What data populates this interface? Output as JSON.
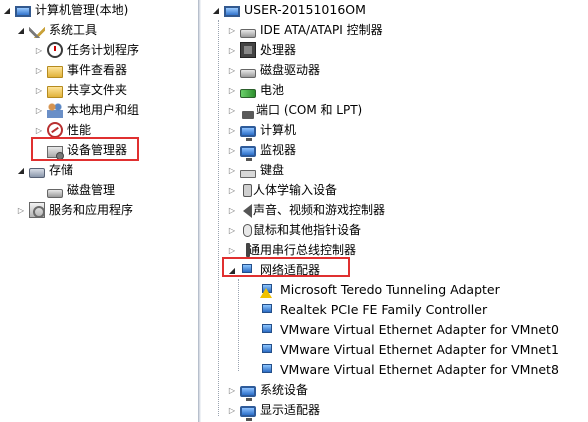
{
  "left_tree": {
    "root": "计算机管理(本地)",
    "system_tools": "系统工具",
    "task_scheduler": "任务计划程序",
    "event_viewer": "事件查看器",
    "shared_folders": "共享文件夹",
    "local_users": "本地用户和组",
    "performance": "性能",
    "device_manager": "设备管理器",
    "storage": "存储",
    "disk_management": "磁盘管理",
    "services": "服务和应用程序"
  },
  "right_tree": {
    "root": "USER-20151016OM",
    "categories": [
      "IDE ATA/ATAPI 控制器",
      "处理器",
      "磁盘驱动器",
      "电池",
      "端口 (COM 和 LPT)",
      "计算机",
      "监视器",
      "键盘",
      "人体学输入设备",
      "声音、视频和游戏控制器",
      "鼠标和其他指针设备",
      "通用串行总线控制器"
    ],
    "network_adapters": "网络适配器",
    "adapters": [
      "Microsoft Teredo Tunneling Adapter",
      "Realtek PCIe FE Family Controller",
      "VMware Virtual Ethernet Adapter for VMnet0",
      "VMware Virtual Ethernet Adapter for VMnet1",
      "VMware Virtual Ethernet Adapter for VMnet8"
    ],
    "system_devices": "系统设备",
    "display_adapters": "显示适配器"
  },
  "colors": {
    "highlight_box": "#e03030",
    "splitter": "#d6dbe4"
  },
  "icons": {
    "expand_closed": "▷",
    "expand_open": "◢"
  }
}
